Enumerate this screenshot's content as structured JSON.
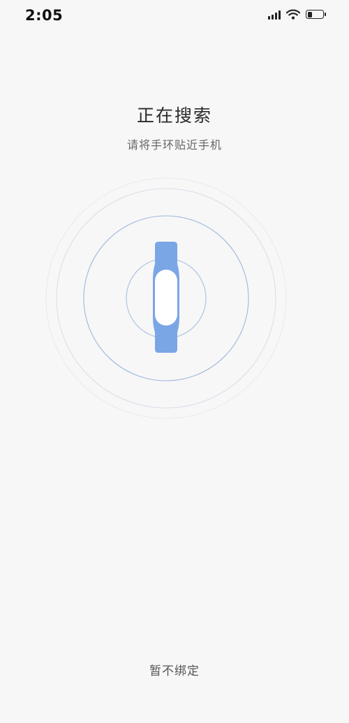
{
  "status_bar": {
    "time": "2:05",
    "icons": [
      "signal-icon",
      "wifi-icon",
      "battery-icon"
    ],
    "battery_level": 0.3
  },
  "search": {
    "title": "正在搜索",
    "subtitle": "请将手环贴近手机"
  },
  "graphic": {
    "icon": "fitness-band-icon",
    "band_color": "#7ba6e6",
    "ring_color": "#a9bfe3"
  },
  "footer": {
    "skip_label": "暂不绑定"
  }
}
